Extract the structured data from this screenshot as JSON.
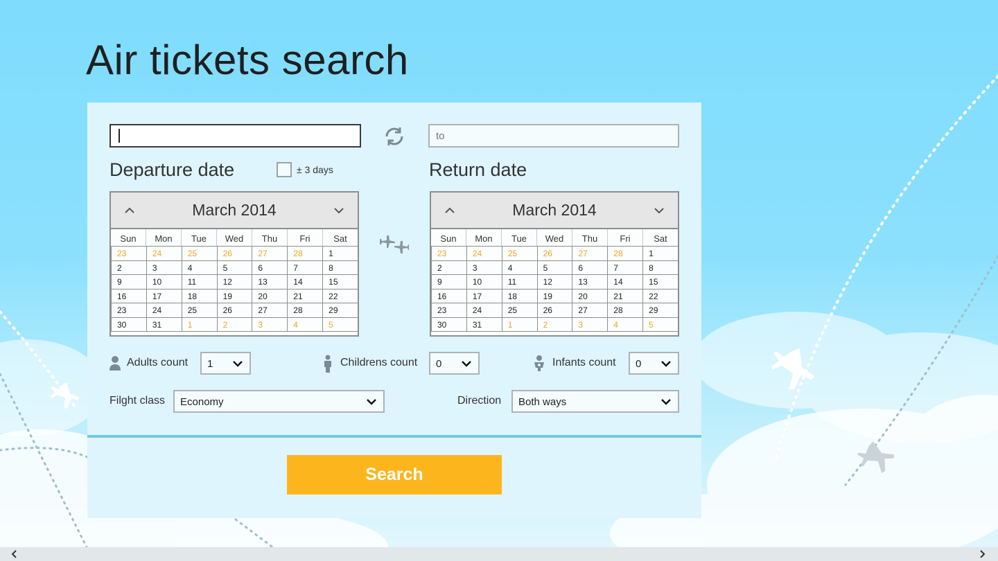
{
  "page": {
    "title": "Air tickets search"
  },
  "route": {
    "from_value": "",
    "to_placeholder": "to"
  },
  "departure": {
    "label": "Departure date",
    "flex_label": "± 3 days",
    "flex_checked": false,
    "calendar": {
      "month_label": "March 2014",
      "weekdays": [
        "Sun",
        "Mon",
        "Tue",
        "Wed",
        "Thu",
        "Fri",
        "Sat"
      ],
      "days": [
        {
          "d": "23",
          "other": true
        },
        {
          "d": "24",
          "other": true
        },
        {
          "d": "25",
          "other": true
        },
        {
          "d": "26",
          "other": true
        },
        {
          "d": "27",
          "other": true
        },
        {
          "d": "28",
          "other": true
        },
        {
          "d": "1",
          "other": false
        },
        {
          "d": "2",
          "other": false
        },
        {
          "d": "3",
          "other": false
        },
        {
          "d": "4",
          "other": false
        },
        {
          "d": "5",
          "other": false
        },
        {
          "d": "6",
          "other": false
        },
        {
          "d": "7",
          "other": false
        },
        {
          "d": "8",
          "other": false
        },
        {
          "d": "9",
          "other": false
        },
        {
          "d": "10",
          "other": false
        },
        {
          "d": "11",
          "other": false
        },
        {
          "d": "12",
          "other": false
        },
        {
          "d": "13",
          "other": false
        },
        {
          "d": "14",
          "other": false
        },
        {
          "d": "15",
          "other": false
        },
        {
          "d": "16",
          "other": false
        },
        {
          "d": "17",
          "other": false
        },
        {
          "d": "18",
          "other": false
        },
        {
          "d": "19",
          "other": false
        },
        {
          "d": "20",
          "other": false
        },
        {
          "d": "21",
          "other": false
        },
        {
          "d": "22",
          "other": false
        },
        {
          "d": "23",
          "other": false
        },
        {
          "d": "24",
          "other": false
        },
        {
          "d": "25",
          "other": false
        },
        {
          "d": "26",
          "other": false
        },
        {
          "d": "27",
          "other": false
        },
        {
          "d": "28",
          "other": false
        },
        {
          "d": "29",
          "other": false
        },
        {
          "d": "30",
          "other": false
        },
        {
          "d": "31",
          "other": false
        },
        {
          "d": "1",
          "other": true
        },
        {
          "d": "2",
          "other": true
        },
        {
          "d": "3",
          "other": true
        },
        {
          "d": "4",
          "other": true
        },
        {
          "d": "5",
          "other": true
        }
      ]
    }
  },
  "return": {
    "label": "Return date",
    "calendar": {
      "month_label": "March 2014",
      "weekdays": [
        "Sun",
        "Mon",
        "Tue",
        "Wed",
        "Thu",
        "Fri",
        "Sat"
      ],
      "days": [
        {
          "d": "23",
          "other": true
        },
        {
          "d": "24",
          "other": true
        },
        {
          "d": "25",
          "other": true
        },
        {
          "d": "26",
          "other": true
        },
        {
          "d": "27",
          "other": true
        },
        {
          "d": "28",
          "other": true
        },
        {
          "d": "1",
          "other": false
        },
        {
          "d": "2",
          "other": false
        },
        {
          "d": "3",
          "other": false
        },
        {
          "d": "4",
          "other": false
        },
        {
          "d": "5",
          "other": false
        },
        {
          "d": "6",
          "other": false
        },
        {
          "d": "7",
          "other": false
        },
        {
          "d": "8",
          "other": false
        },
        {
          "d": "9",
          "other": false
        },
        {
          "d": "10",
          "other": false
        },
        {
          "d": "11",
          "other": false
        },
        {
          "d": "12",
          "other": false
        },
        {
          "d": "13",
          "other": false
        },
        {
          "d": "14",
          "other": false
        },
        {
          "d": "15",
          "other": false
        },
        {
          "d": "16",
          "other": false
        },
        {
          "d": "17",
          "other": false
        },
        {
          "d": "18",
          "other": false
        },
        {
          "d": "19",
          "other": false
        },
        {
          "d": "20",
          "other": false
        },
        {
          "d": "21",
          "other": false
        },
        {
          "d": "22",
          "other": false
        },
        {
          "d": "23",
          "other": false
        },
        {
          "d": "24",
          "other": false
        },
        {
          "d": "25",
          "other": false
        },
        {
          "d": "26",
          "other": false
        },
        {
          "d": "27",
          "other": false
        },
        {
          "d": "28",
          "other": false
        },
        {
          "d": "29",
          "other": false
        },
        {
          "d": "30",
          "other": false
        },
        {
          "d": "31",
          "other": false
        },
        {
          "d": "1",
          "other": true
        },
        {
          "d": "2",
          "other": true
        },
        {
          "d": "3",
          "other": true
        },
        {
          "d": "4",
          "other": true
        },
        {
          "d": "5",
          "other": true
        }
      ]
    }
  },
  "passengers": {
    "adults": {
      "label": "Adults count",
      "value": "1",
      "icon": "adult-icon"
    },
    "children": {
      "label": "Childrens count",
      "value": "0",
      "icon": "child-icon"
    },
    "infants": {
      "label": "Infants count",
      "value": "0",
      "icon": "infant-icon"
    }
  },
  "flight_class": {
    "label": "Filght class",
    "value": "Economy"
  },
  "direction": {
    "label": "Direction",
    "value": "Both ways"
  },
  "search": {
    "label": "Search"
  },
  "colors": {
    "accent": "#fdb51e",
    "panel": "#dff5fe",
    "divider": "#6ccbe8",
    "other_month_day": "#f2a51c",
    "sky": "#7fdcfd"
  }
}
